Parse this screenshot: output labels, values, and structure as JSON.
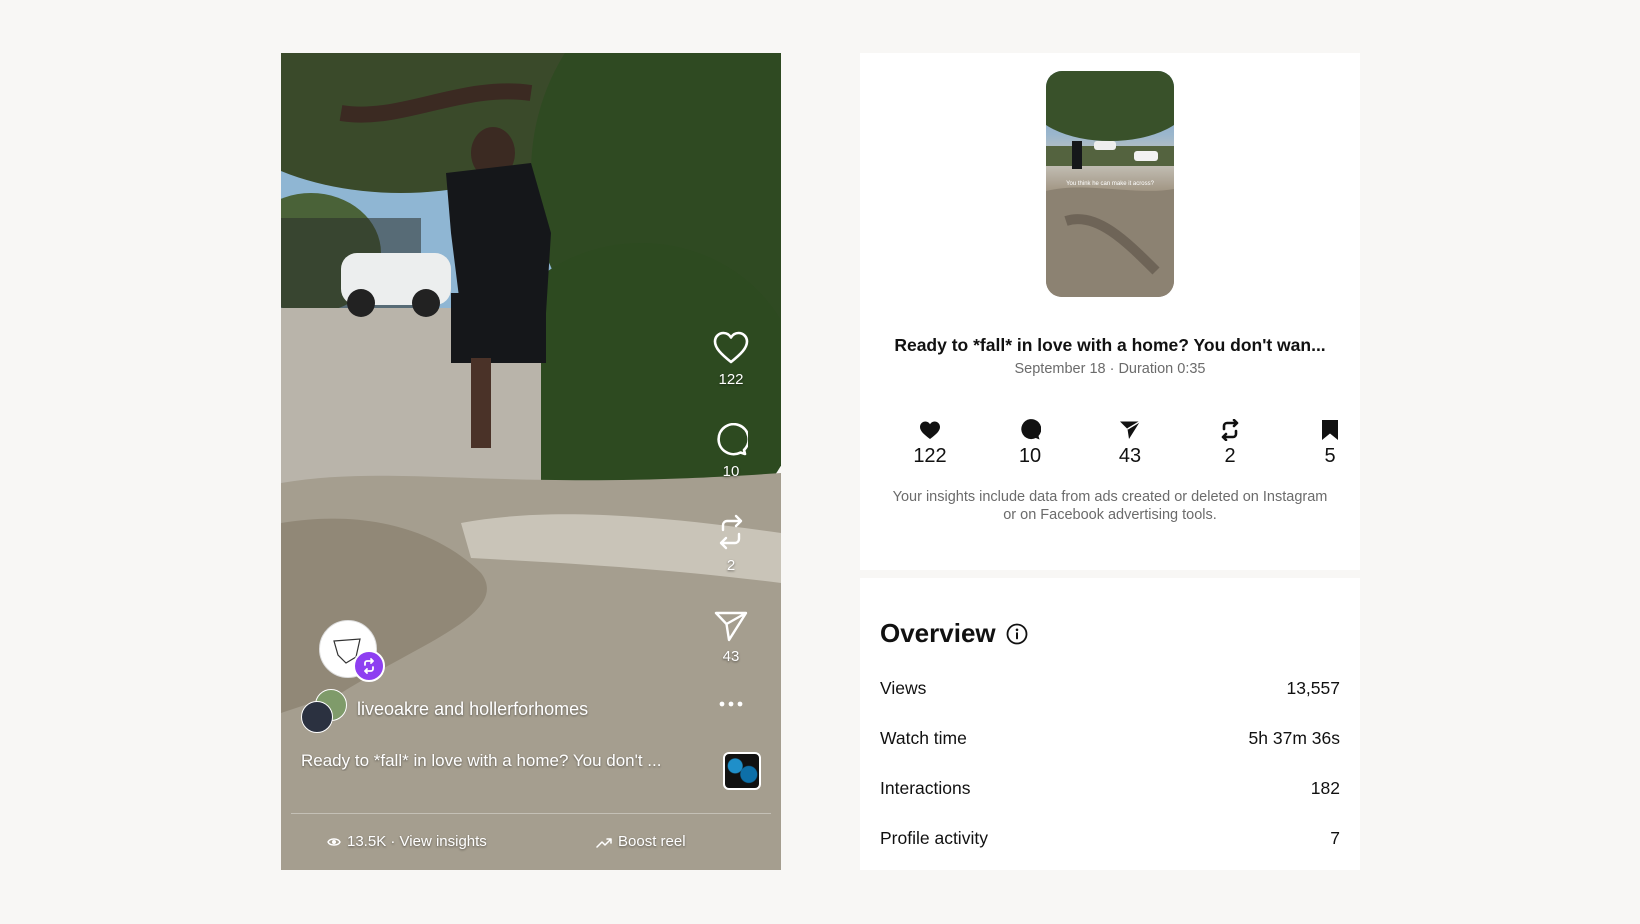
{
  "reel": {
    "actions": [
      {
        "icon": "heart-icon",
        "count": "122"
      },
      {
        "icon": "comment-icon",
        "count": "10"
      },
      {
        "icon": "repost-icon",
        "count": "2"
      },
      {
        "icon": "send-icon",
        "count": "43"
      }
    ],
    "owner": "liveoakre",
    "owner_conjunction": "and",
    "collaborator": "hollerforhomes",
    "caption": "Ready to *fall* in love with a home? You don't ...",
    "views_link": "13.5K · View insights",
    "boost_link": "Boost reel"
  },
  "insights": {
    "thumbnail_overlay_text": "You think he can make it across?",
    "title": "Ready to *fall* in love with a home? You don't wan...",
    "date": "September 18",
    "duration": "Duration 0:35",
    "stats": [
      {
        "icon": "heart-filled-icon",
        "value": "122"
      },
      {
        "icon": "comment-filled-icon",
        "value": "10"
      },
      {
        "icon": "send-filled-icon",
        "value": "43"
      },
      {
        "icon": "repost-filled-icon",
        "value": "2"
      },
      {
        "icon": "bookmark-filled-icon",
        "value": "5"
      }
    ],
    "disclaimer": "Your insights include data from ads created or deleted on Instagram or on Facebook advertising tools.",
    "overview": {
      "title": "Overview",
      "rows": [
        {
          "label": "Views",
          "value": "13,557"
        },
        {
          "label": "Watch time",
          "value": "5h 37m 36s"
        },
        {
          "label": "Interactions",
          "value": "182"
        },
        {
          "label": "Profile activity",
          "value": "7"
        }
      ]
    }
  },
  "colors": {
    "page_bg": "#f8f7f5",
    "panel_bg": "#ffffff",
    "muted_text": "#6b6b6b",
    "collab_badge": "#8e3ff1"
  }
}
